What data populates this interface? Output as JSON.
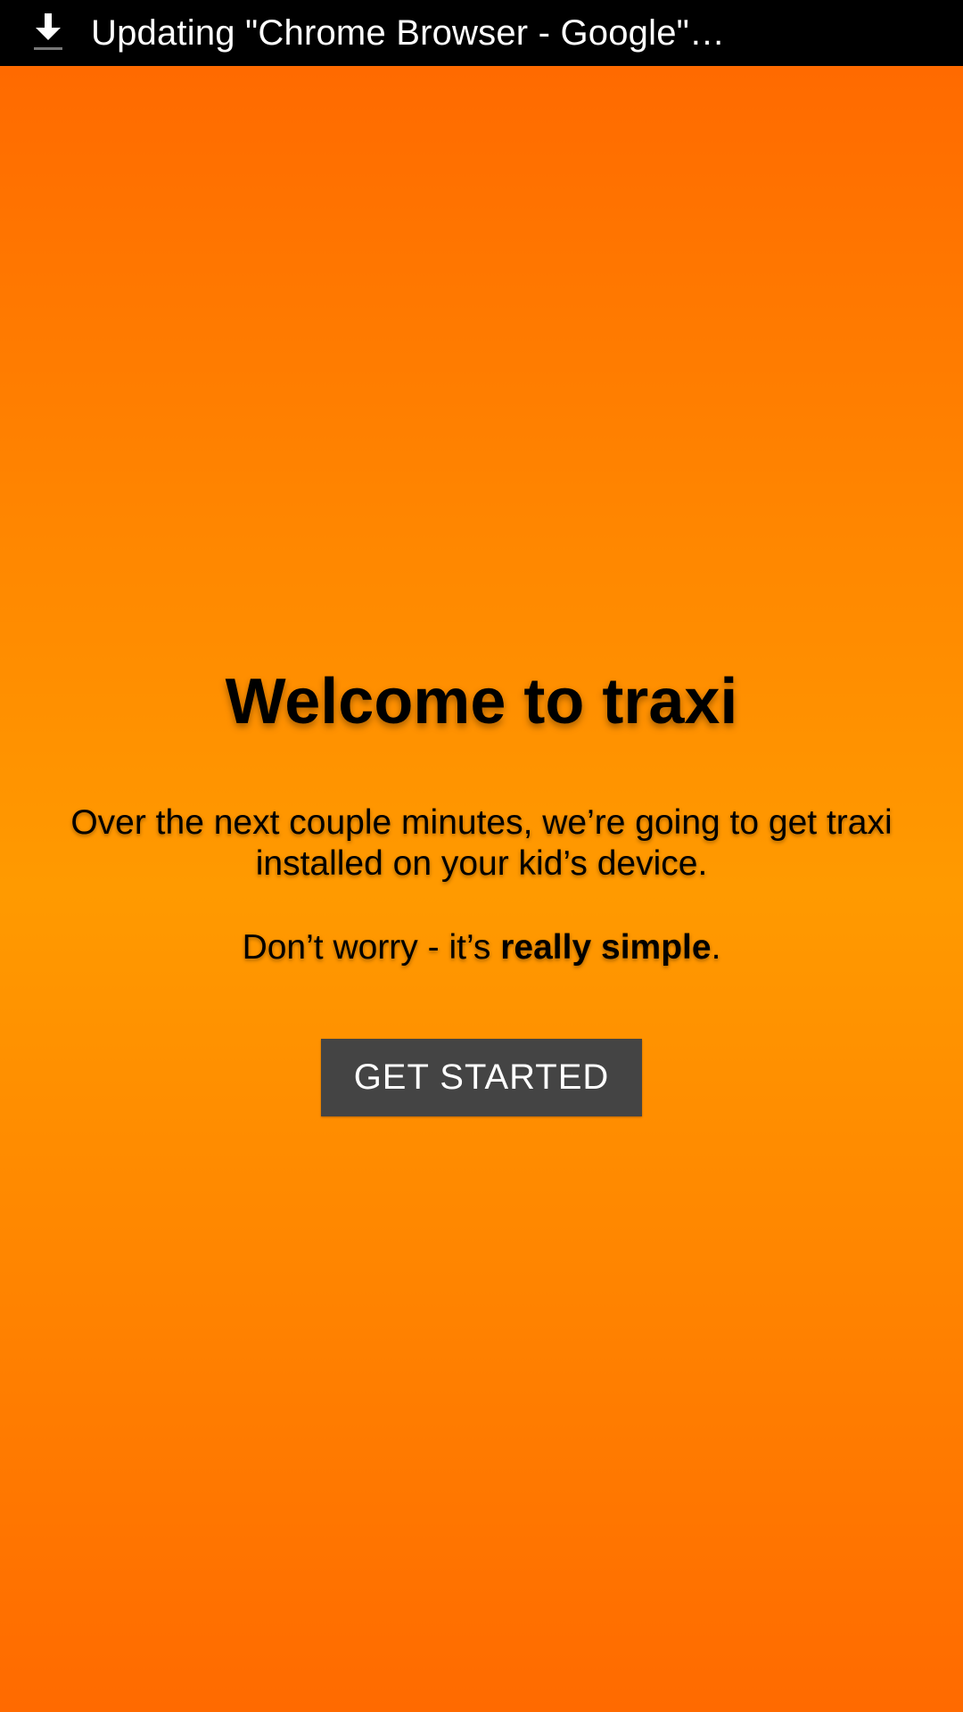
{
  "status_bar": {
    "icon": "download-icon",
    "text": "Updating \"Chrome Browser - Google\"…"
  },
  "welcome": {
    "title": "Welcome to traxi",
    "line1": "Over the next couple minutes, we’re going to get traxi installed on your kid’s device.",
    "line2_pre": "Don’t worry - it’s ",
    "line2_bold": "really simple",
    "line2_post": ".",
    "button_label": "GET STARTED"
  },
  "colors": {
    "background_top": "#ff6a00",
    "background_middle": "#ff9a00",
    "button": "#444444",
    "status_bar": "#000000"
  }
}
